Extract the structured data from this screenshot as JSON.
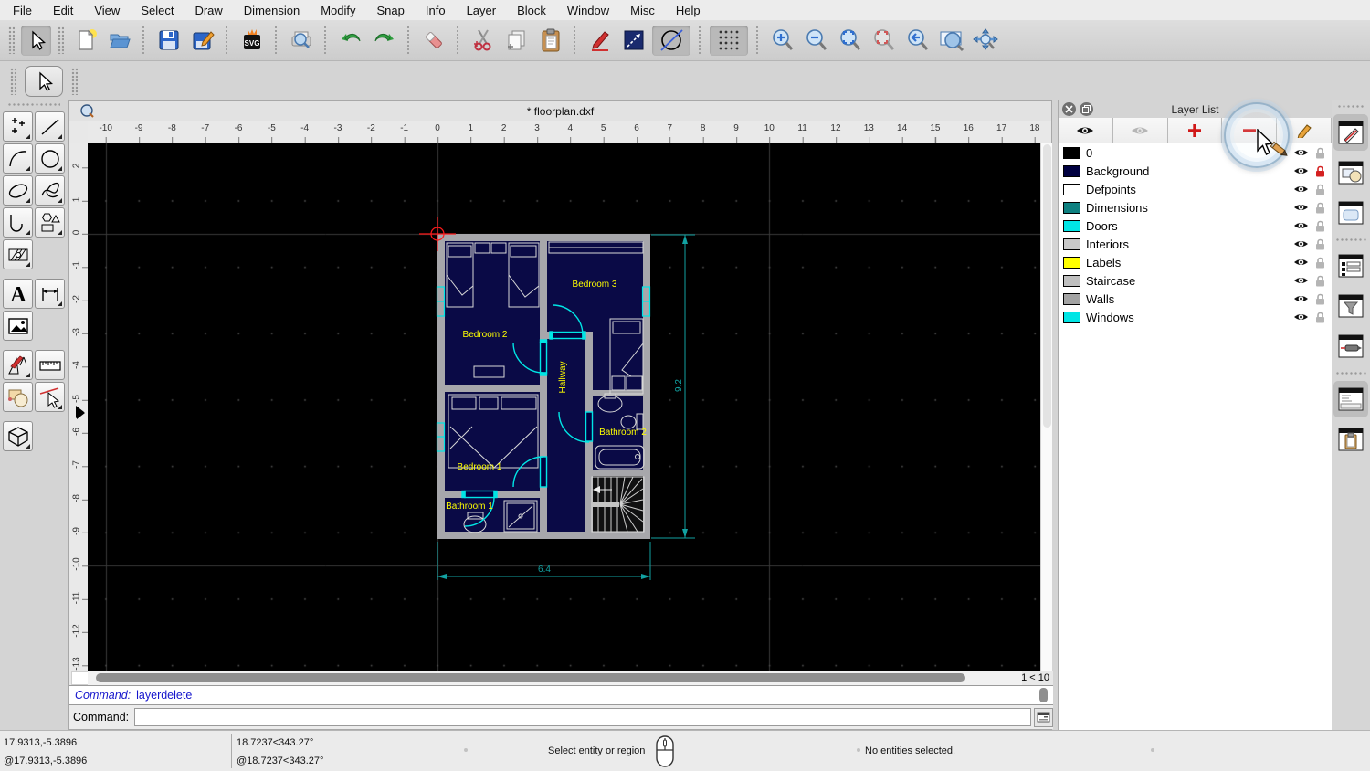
{
  "menubar": {
    "items": [
      "File",
      "Edit",
      "View",
      "Select",
      "Draw",
      "Dimension",
      "Modify",
      "Snap",
      "Info",
      "Layer",
      "Block",
      "Window",
      "Misc",
      "Help"
    ]
  },
  "document": {
    "title": "* floorplan.dxf",
    "page_indicator": "1 < 10"
  },
  "toolbar": {
    "svg_label": "SVG",
    "icons": [
      "select-cursor",
      "new-file",
      "open-file",
      "save",
      "save-as",
      "svg-export",
      "print-preview",
      "undo",
      "redo",
      "eraser",
      "cut",
      "copy",
      "paste",
      "edit-pen",
      "draw-line",
      "isometric-circle",
      "grid-toggle",
      "zoom-in",
      "zoom-out",
      "zoom-auto",
      "zoom-previous",
      "zoom-back",
      "zoom-window",
      "zoom-pan"
    ]
  },
  "palette": {
    "icons": [
      "points",
      "line",
      "arc",
      "circle",
      "ellipse",
      "spline",
      "polyline",
      "shapes",
      "hatch",
      "text",
      "dimension",
      "image",
      "modify",
      "measure",
      "order",
      "delete",
      "block"
    ]
  },
  "ruler": {
    "h_labels": [
      -10,
      -9,
      -8,
      -7,
      -6,
      -5,
      -4,
      -3,
      -2,
      -1,
      0,
      1,
      2,
      3,
      4,
      5,
      6,
      7,
      8,
      9,
      10,
      11,
      12,
      13,
      14,
      15,
      16,
      17,
      18
    ],
    "v_labels": [
      2,
      1,
      0,
      -1,
      -2,
      -3,
      -4,
      -5,
      -6,
      -7,
      -8,
      -9,
      -10,
      -11,
      -12,
      -13
    ]
  },
  "floorplan": {
    "labels": {
      "bedroom1": "Bedroom 1",
      "bedroom2": "Bedroom 2",
      "bedroom3": "Bedroom 3",
      "bathroom1": "Bathroom 1",
      "bathroom2": "Bathroom 2",
      "hallway": "Hallway"
    },
    "dimensions": {
      "width": "6.4",
      "height": "9.2"
    },
    "colors": {
      "background": "#000040",
      "walls": "#a7a7ab",
      "doors": "#00e5e5",
      "windows": "#00e5e5",
      "labels": "#ffff00",
      "dimensions": "#12a2a2",
      "furniture": "#d8d8d8",
      "origin_marker": "#ff1a1a"
    }
  },
  "layer_panel": {
    "title": "Layer List",
    "layers": [
      {
        "name": "0",
        "color": "#000000",
        "visible": true,
        "locked": false
      },
      {
        "name": "Background",
        "color": "#000040",
        "visible": true,
        "locked": true
      },
      {
        "name": "Defpoints",
        "color": "#ffffff",
        "visible": true,
        "locked": false
      },
      {
        "name": "Dimensions",
        "color": "#0e8080",
        "visible": true,
        "locked": false
      },
      {
        "name": "Doors",
        "color": "#00e5e5",
        "visible": true,
        "locked": false
      },
      {
        "name": "Interiors",
        "color": "#c8c8c8",
        "visible": true,
        "locked": false
      },
      {
        "name": "Labels",
        "color": "#ffff00",
        "visible": true,
        "locked": false
      },
      {
        "name": "Staircase",
        "color": "#bfbfbf",
        "visible": true,
        "locked": false
      },
      {
        "name": "Walls",
        "color": "#a3a3a3",
        "visible": true,
        "locked": false
      },
      {
        "name": "Windows",
        "color": "#00e5e5",
        "visible": true,
        "locked": false
      }
    ]
  },
  "command": {
    "history_label": "Command:",
    "history_value": "layerdelete",
    "prompt_label": "Command:"
  },
  "statusbar": {
    "abs_coord": "17.9313,-5.3896",
    "rel_coord": "@17.9313,-5.3896",
    "abs_polar": "18.7237<343.27°",
    "rel_polar": "@18.7237<343.27°",
    "hint": "Select entity or region",
    "selection_status": "No entities selected."
  }
}
